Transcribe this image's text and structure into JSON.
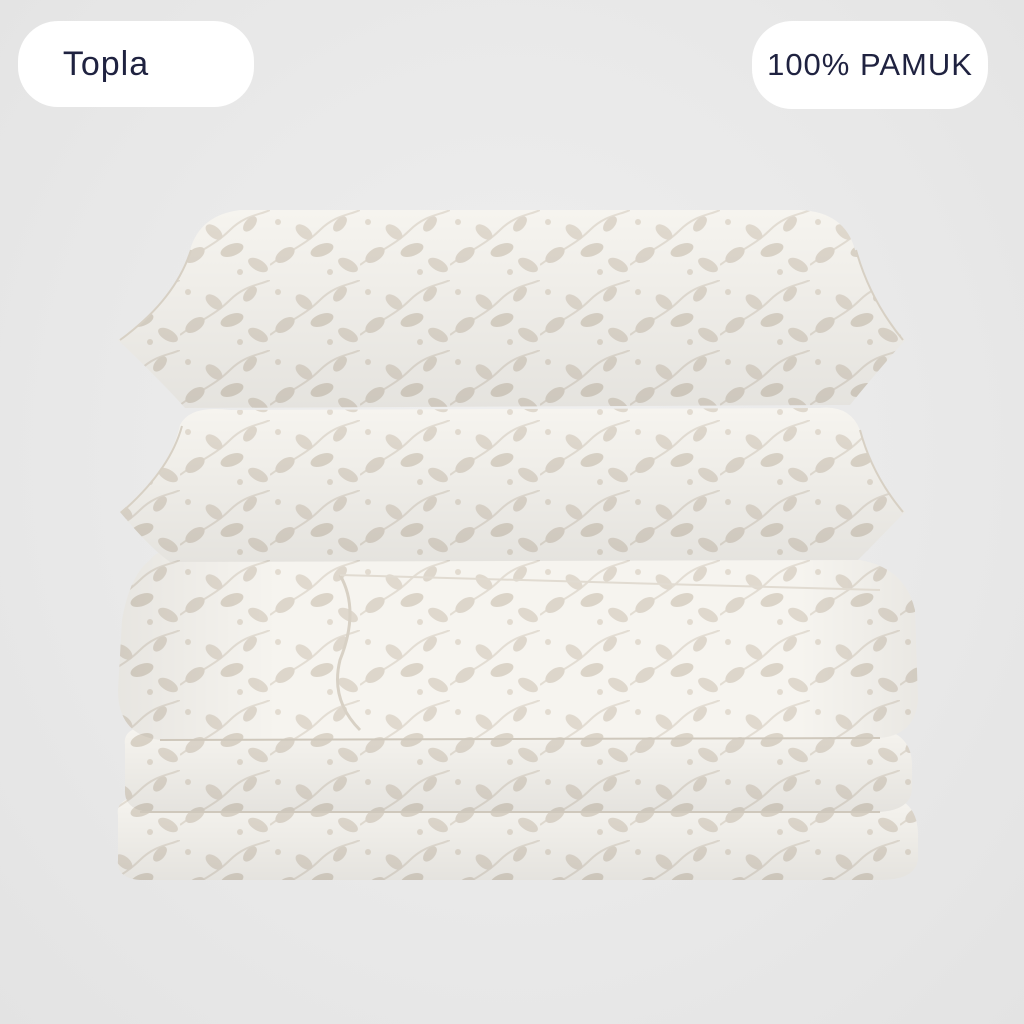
{
  "badges": {
    "left_label": "Topla",
    "right_label": "100% PAMUK"
  },
  "product": {
    "items": [
      "pillow",
      "pillow",
      "folded-duvet-cover"
    ],
    "pattern": "leaf-vine",
    "colors": {
      "background": "#e8e8e8",
      "fabric": "#f6f4ef",
      "leaf": "#ddd6cb",
      "badge_text": "#1f2240"
    }
  }
}
